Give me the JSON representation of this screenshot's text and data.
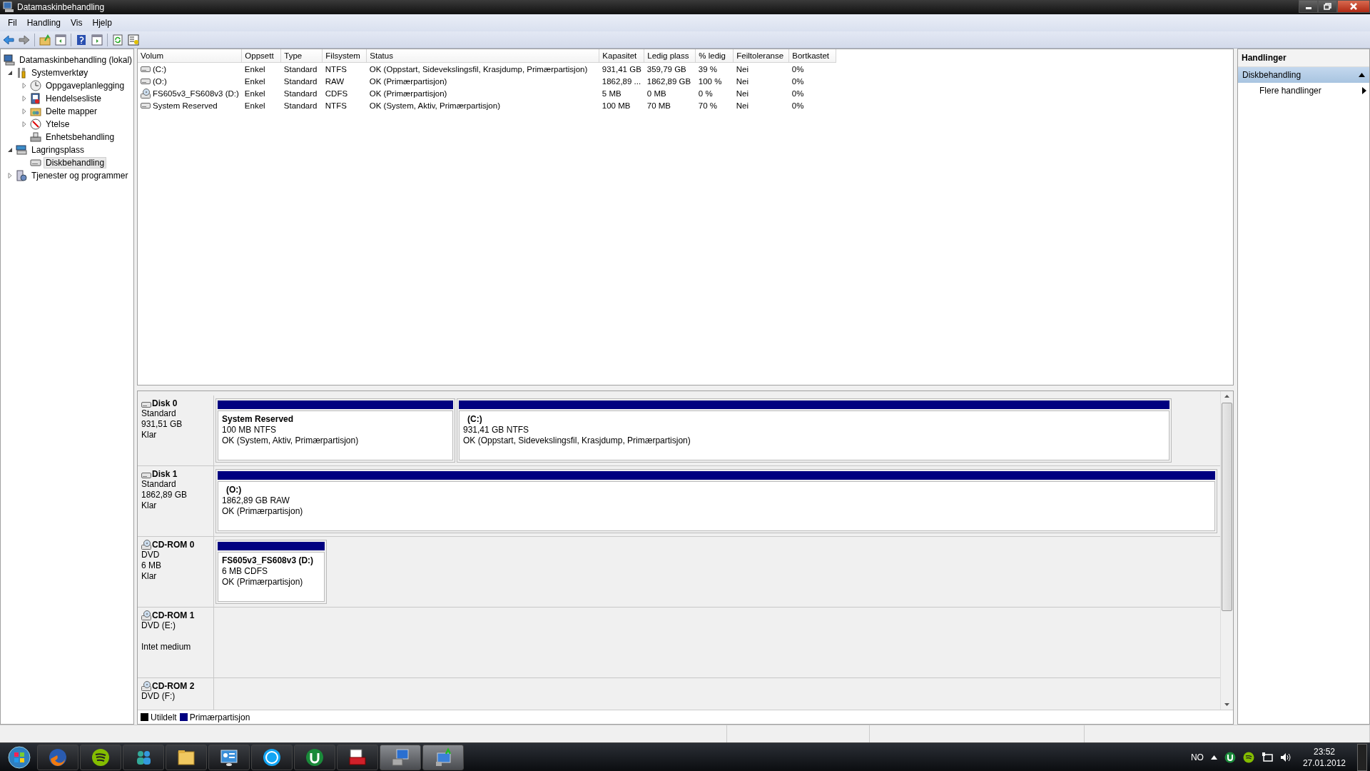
{
  "window": {
    "title": "Datamaskinbehandling"
  },
  "menu": [
    "Fil",
    "Handling",
    "Vis",
    "Hjelp"
  ],
  "tree": [
    {
      "label": "Datamaskinbehandling (lokal)",
      "selected": false,
      "children": [
        {
          "label": "Systemverktøy",
          "expanded": true,
          "selected": false,
          "children": [
            {
              "label": "Oppgaveplanlegging",
              "expanded": false,
              "selected": false
            },
            {
              "label": "Hendelsesliste",
              "expanded": false,
              "selected": false
            },
            {
              "label": "Delte mapper",
              "expanded": false,
              "selected": false
            },
            {
              "label": "Ytelse",
              "expanded": false,
              "selected": false
            },
            {
              "label": "Enhetsbehandling",
              "selected": false
            }
          ]
        },
        {
          "label": "Lagringsplass",
          "expanded": true,
          "selected": false,
          "children": [
            {
              "label": "Diskbehandling",
              "selected": true
            }
          ]
        },
        {
          "label": "Tjenester og programmer",
          "expanded": false,
          "selected": false
        }
      ]
    }
  ],
  "table": {
    "columns": [
      "Volum",
      "Oppsett",
      "Type",
      "Filsystem",
      "Status",
      "Kapasitet",
      "Ledig plass",
      "% ledig",
      "Feiltoleranse",
      "Bortkastet"
    ],
    "rows": [
      {
        "kind": "disk",
        "cells": [
          "(C:)",
          "Enkel",
          "Standard",
          "NTFS",
          "OK (Oppstart, Sidevekslingsfil, Krasjdump, Primærpartisjon)",
          "931,41 GB",
          "359,79 GB",
          "39 %",
          "Nei",
          "0%"
        ]
      },
      {
        "kind": "disk",
        "cells": [
          "(O:)",
          "Enkel",
          "Standard",
          "RAW",
          "OK (Primærpartisjon)",
          "1862,89 ...",
          "1862,89 GB",
          "100 %",
          "Nei",
          "0%"
        ]
      },
      {
        "kind": "cdrom",
        "cells": [
          "FS605v3_FS608v3 (D:)",
          "Enkel",
          "Standard",
          "CDFS",
          "OK (Primærpartisjon)",
          "5 MB",
          "0 MB",
          "0 %",
          "Nei",
          "0%"
        ]
      },
      {
        "kind": "disk",
        "cells": [
          "System Reserved",
          "Enkel",
          "Standard",
          "NTFS",
          "OK (System, Aktiv, Primærpartisjon)",
          "100 MB",
          "70 MB",
          "70 %",
          "Nei",
          "0%"
        ]
      }
    ]
  },
  "disks": [
    {
      "kind": "disk",
      "name": "Disk 0",
      "lines": [
        "Standard",
        "931,51 GB",
        "Klar"
      ],
      "partitions": [
        {
          "title": "System Reserved",
          "size": "100 MB NTFS",
          "status": "OK (System, Aktiv, Primærpartisjon)"
        },
        {
          "title": "(C:)",
          "size": "931,41 GB NTFS",
          "status": "OK (Oppstart, Sidevekslingsfil, Krasjdump, Primærpartisjon)"
        }
      ]
    },
    {
      "kind": "disk",
      "name": "Disk 1",
      "lines": [
        "Standard",
        "1862,89 GB",
        "Klar"
      ],
      "partitions": [
        {
          "title": "(O:)",
          "size": "1862,89 GB RAW",
          "status": "OK (Primærpartisjon)"
        }
      ]
    },
    {
      "kind": "cdrom",
      "name": "CD-ROM 0",
      "lines": [
        "DVD",
        "6 MB",
        "Klar"
      ],
      "partitions": [
        {
          "title": "FS605v3_FS608v3  (D:)",
          "size": "6 MB CDFS",
          "status": "OK (Primærpartisjon)"
        }
      ]
    },
    {
      "kind": "cdrom",
      "name": "CD-ROM 1",
      "lines": [
        "DVD (E:)"
      ],
      "note": "Intet medium"
    },
    {
      "kind": "cdrom",
      "name": "CD-ROM 2",
      "lines": [
        "DVD (F:)"
      ]
    }
  ],
  "legend": [
    {
      "label": "Utildelt",
      "color": "#000000"
    },
    {
      "label": "Primærpartisjon",
      "color": "#000080"
    }
  ],
  "actions": {
    "header": "Handlinger",
    "sections": [
      {
        "title": "Diskbehandling",
        "expanded": true,
        "items": [
          {
            "label": "Flere handlinger"
          }
        ]
      }
    ]
  },
  "tray": {
    "language": "NO",
    "time": "23:52",
    "date": "27.01.2012"
  }
}
